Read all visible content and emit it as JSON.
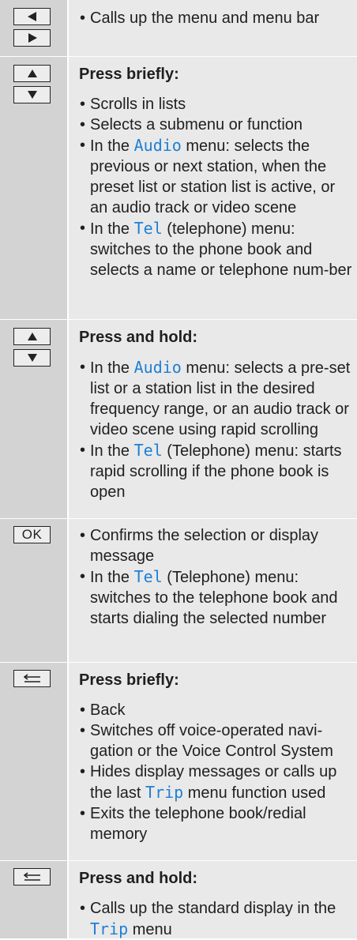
{
  "rows": [
    {
      "keys": [
        "arrow-left",
        "arrow-right"
      ],
      "heading": "",
      "items": [
        [
          {
            "t": "Calls up the menu and menu bar"
          }
        ]
      ]
    },
    {
      "keys": [
        "arrow-up",
        "arrow-down"
      ],
      "heading": "Press briefly:",
      "items": [
        [
          {
            "t": "Scrolls in lists"
          }
        ],
        [
          {
            "t": "Selects a submenu or function"
          }
        ],
        [
          {
            "t": "In the "
          },
          {
            "t": "Audio",
            "m": 1
          },
          {
            "t": " menu: selects the previous or next station, when the preset list or station list is active, or an audio track or video scene"
          }
        ],
        [
          {
            "t": "In the "
          },
          {
            "t": "Tel",
            "m": 1
          },
          {
            "t": " (telephone) menu: switches to the phone book and selects a name or telephone num-ber"
          }
        ]
      ]
    },
    {
      "keys": [
        "arrow-up",
        "arrow-down"
      ],
      "heading": "Press and hold:",
      "items": [
        [
          {
            "t": "In the "
          },
          {
            "t": "Audio",
            "m": 1
          },
          {
            "t": " menu: selects a pre-set list or a station list in the desired frequency range, or an audio track or video scene using rapid scrolling"
          }
        ],
        [
          {
            "t": "In the "
          },
          {
            "t": "Tel",
            "m": 1
          },
          {
            "t": " (Telephone) menu: starts rapid scrolling if the phone book is open"
          }
        ]
      ]
    },
    {
      "keys": [
        "ok"
      ],
      "ok_label": "OK",
      "heading": "",
      "items": [
        [
          {
            "t": "Confirms the selection or display message"
          }
        ],
        [
          {
            "t": "In the "
          },
          {
            "t": "Tel",
            "m": 1
          },
          {
            "t": " (Telephone) menu: switches to the telephone book and starts dialing the selected number"
          }
        ]
      ]
    },
    {
      "keys": [
        "back"
      ],
      "heading": "Press briefly:",
      "items": [
        [
          {
            "t": "Back"
          }
        ],
        [
          {
            "t": "Switches off voice-operated navi-gation or the Voice Control System"
          }
        ],
        [
          {
            "t": "Hides display messages or calls up the last "
          },
          {
            "t": "Trip",
            "m": 1
          },
          {
            "t": " menu function used"
          }
        ],
        [
          {
            "t": "Exits the telephone book/redial memory"
          }
        ]
      ]
    },
    {
      "keys": [
        "back"
      ],
      "heading": "Press and hold:",
      "items": [
        [
          {
            "t": "Calls up the standard display in the "
          },
          {
            "t": "Trip",
            "m": 1
          },
          {
            "t": " menu"
          }
        ]
      ]
    }
  ]
}
